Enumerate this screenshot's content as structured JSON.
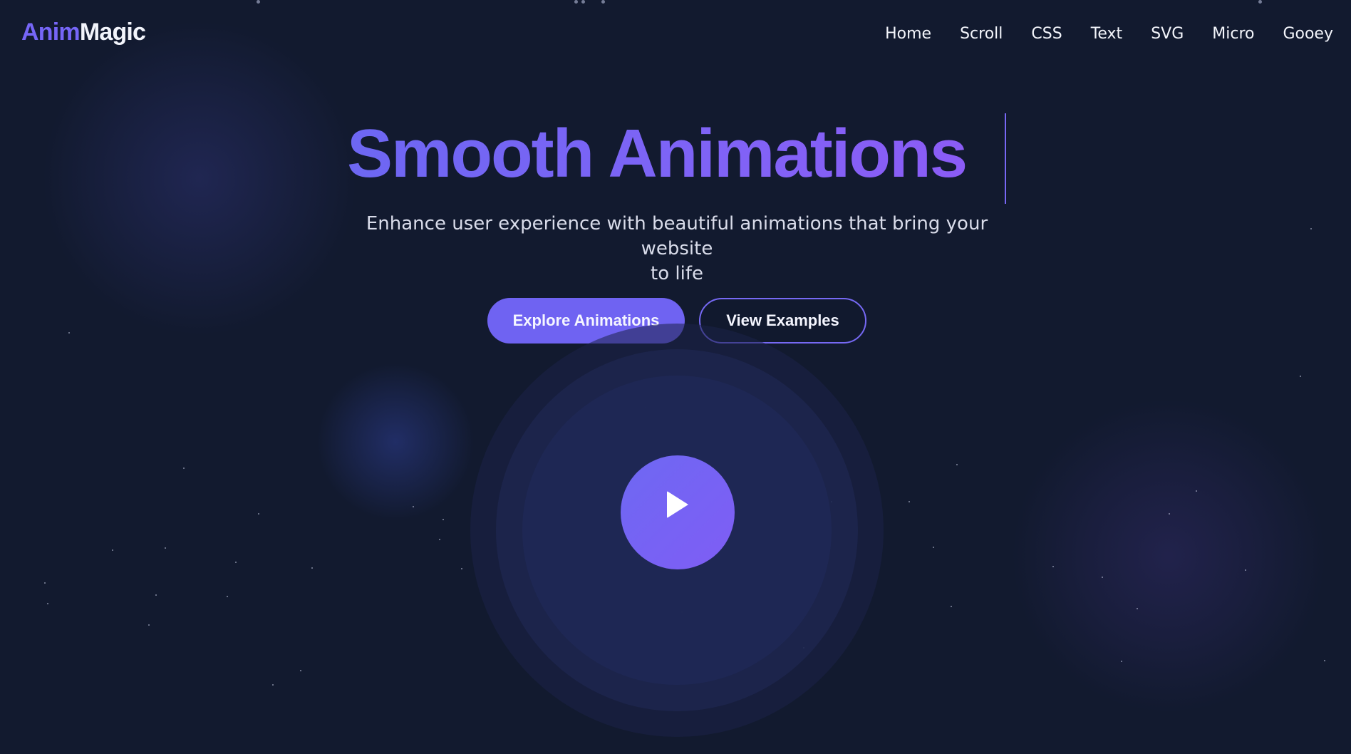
{
  "header": {
    "logo": {
      "part1": "Anim",
      "part2": "Magic"
    },
    "nav": [
      "Home",
      "Scroll",
      "CSS",
      "Text",
      "SVG",
      "Micro",
      "Gooey"
    ]
  },
  "hero": {
    "title": "Smooth Animations",
    "subtitle_line1": "Enhance user experience with beautiful animations that bring your website",
    "subtitle_line2": "to life",
    "buttons": {
      "primary": "Explore Animations",
      "secondary": "View Examples"
    }
  },
  "theme": {
    "background": "#111a2e",
    "accent": "#6f63f2",
    "accent_alt": "#8b5cf6",
    "text": "#f5f6ff"
  },
  "icons": {
    "play": "play-icon"
  }
}
